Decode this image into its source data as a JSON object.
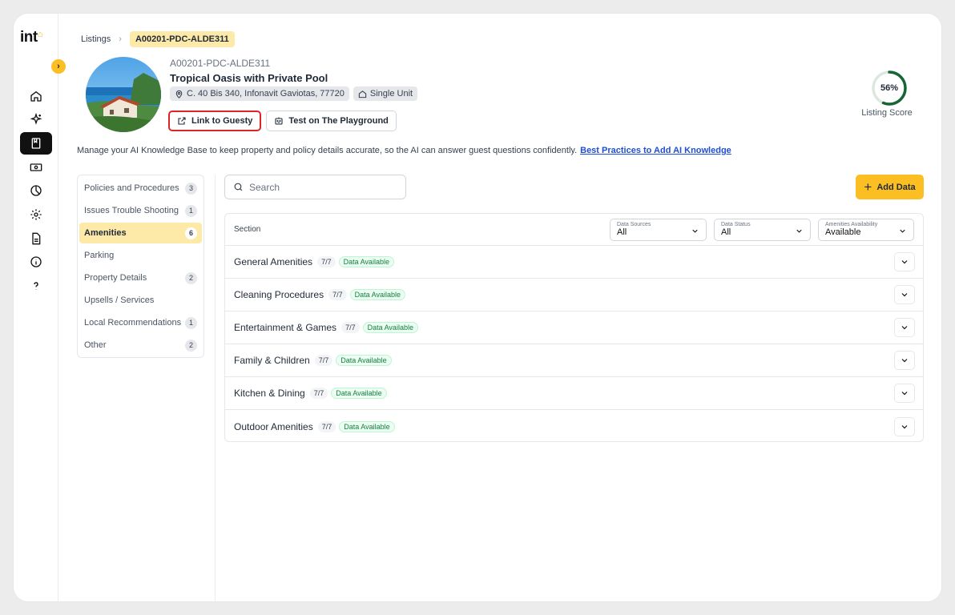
{
  "app": {
    "logo_text": "int",
    "logo_mark": "⌂"
  },
  "nav": [
    {
      "icon": "home-icon",
      "active": false
    },
    {
      "icon": "sparkle-icon",
      "active": false
    },
    {
      "icon": "book-icon",
      "active": true
    },
    {
      "icon": "money-icon",
      "active": false
    },
    {
      "icon": "chart-icon",
      "active": false
    },
    {
      "icon": "gear-icon",
      "active": false
    },
    {
      "icon": "document-icon",
      "active": false
    },
    {
      "icon": "info-icon",
      "active": false
    },
    {
      "icon": "help-icon",
      "active": false
    }
  ],
  "breadcrumb": {
    "parent": "Listings",
    "separator": "›",
    "current": "A00201-PDC-ALDE311"
  },
  "listing": {
    "id": "A00201-PDC-ALDE311",
    "title": "Tropical Oasis with Private Pool",
    "address": "C. 40 Bis 340, Infonavit Gaviotas, 77720",
    "unit_type": "Single Unit",
    "link_button": "Link to Guesty",
    "test_button": "Test on The Playground"
  },
  "score": {
    "value_text": "56%",
    "value": 0.56,
    "label": "Listing Score",
    "color": "#166534"
  },
  "intro": {
    "text": "Manage your AI Knowledge Base to keep property and policy details accurate, so the AI can answer guest questions confidently.",
    "link": "Best Practices to Add AI Knowledge"
  },
  "categories": [
    {
      "label": "Policies and Procedures",
      "count": "3",
      "active": false
    },
    {
      "label": "Issues Trouble Shooting",
      "count": "1",
      "active": false
    },
    {
      "label": "Amenities",
      "count": "6",
      "active": true
    },
    {
      "label": "Parking",
      "count": "",
      "active": false
    },
    {
      "label": "Property Details",
      "count": "2",
      "active": false
    },
    {
      "label": "Upsells / Services",
      "count": "",
      "active": false
    },
    {
      "label": "Local Recommendations",
      "count": "1",
      "active": false
    },
    {
      "label": "Other",
      "count": "2",
      "active": false
    }
  ],
  "search": {
    "placeholder": "Search"
  },
  "add_button": {
    "label": "Add Data"
  },
  "table": {
    "section_header": "Section",
    "filters": [
      {
        "label": "Data Sources",
        "value": "All"
      },
      {
        "label": "Data Status",
        "value": "All"
      },
      {
        "label": "Amenities Availability",
        "value": "Available"
      }
    ],
    "rows": [
      {
        "name": "General Amenities",
        "fraction": "7/7",
        "status": "Data Available"
      },
      {
        "name": "Cleaning Procedures",
        "fraction": "7/7",
        "status": "Data Available"
      },
      {
        "name": "Entertainment & Games",
        "fraction": "7/7",
        "status": "Data Available"
      },
      {
        "name": "Family & Children",
        "fraction": "7/7",
        "status": "Data Available"
      },
      {
        "name": "Kitchen & Dining",
        "fraction": "7/7",
        "status": "Data Available"
      },
      {
        "name": "Outdoor Amenities",
        "fraction": "7/7",
        "status": "Data Available"
      }
    ]
  },
  "colors": {
    "accent": "#fbbf24",
    "accent_soft": "#fde9a8",
    "link": "#1d4ed8",
    "success": "#15803d",
    "highlight_border": "#dc2626"
  }
}
